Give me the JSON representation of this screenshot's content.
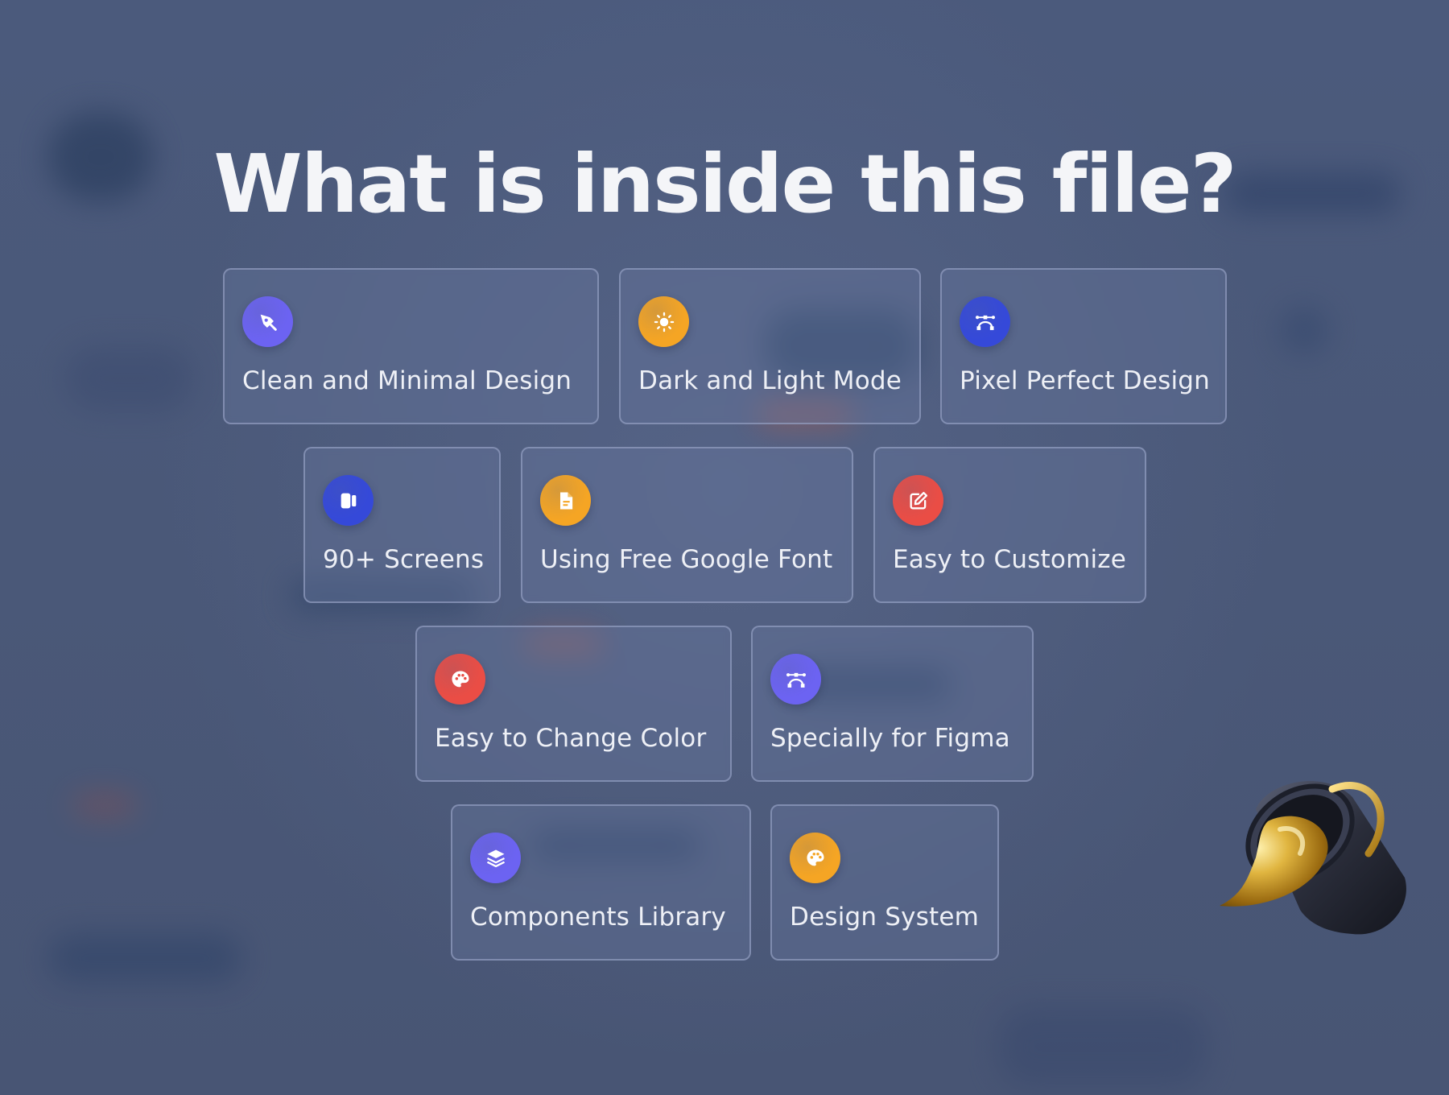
{
  "page": {
    "title": "What is inside this file?"
  },
  "features": [
    {
      "label": "Clean and Minimal Design",
      "icon": "pen-tool-icon",
      "color": "#6c63f2"
    },
    {
      "label": "Dark and Light Mode",
      "icon": "sun-icon",
      "color": "#f5a524"
    },
    {
      "label": "Pixel Perfect Design",
      "icon": "bezier-curve-icon",
      "color": "#3549d9"
    },
    {
      "label": "90+ Screens",
      "icon": "screens-icon",
      "color": "#3549d9"
    },
    {
      "label": "Using Free Google Font",
      "icon": "document-icon",
      "color": "#f5a524"
    },
    {
      "label": "Easy to Customize",
      "icon": "edit-icon",
      "color": "#ea4d45"
    },
    {
      "label": "Easy to Change Color",
      "icon": "palette-icon",
      "color": "#ea4d45"
    },
    {
      "label": "Specially for Figma",
      "icon": "bezier-curve-icon",
      "color": "#6c63f2"
    },
    {
      "label": "Components Library",
      "icon": "layers-icon",
      "color": "#6c63f2"
    },
    {
      "label": "Design System",
      "icon": "palette-icon",
      "color": "#f5a524"
    }
  ],
  "decoration": {
    "illustration": "paint-bucket-icon"
  }
}
